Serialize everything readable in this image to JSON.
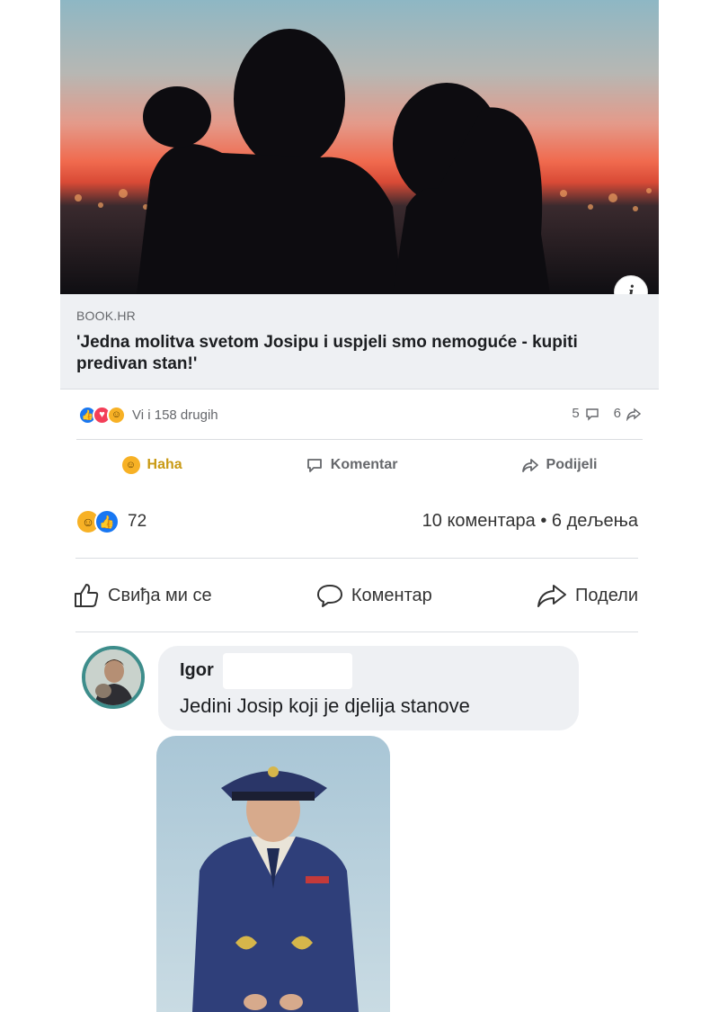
{
  "shared_post": {
    "link_source": "BOOK.HR",
    "link_title": "'Jedna molitva svetom Josipu i uspjeli smo nemoguće - kupiti predivan stan!'",
    "reactions_text": "Vi i 158 drugih",
    "comments_count": "5",
    "shares_count": "6",
    "actions": {
      "haha": "Haha",
      "comment": "Komentar",
      "share": "Podijeli"
    },
    "info_icon": "info-icon"
  },
  "post": {
    "reactions_count": "72",
    "comments_shares": "10 коментара • 6 дељења",
    "actions": {
      "like": "Свиђа ми се",
      "comment": "Коментар",
      "share": "Подели"
    }
  },
  "comment": {
    "author": "Igor",
    "text": "Jedini Josip koji je djelija stanove"
  },
  "colors": {
    "like_blue": "#1877f2",
    "love_red": "#f33e58",
    "haha_yellow": "#f7b125",
    "avatar_ring": "#3d8d8b"
  }
}
